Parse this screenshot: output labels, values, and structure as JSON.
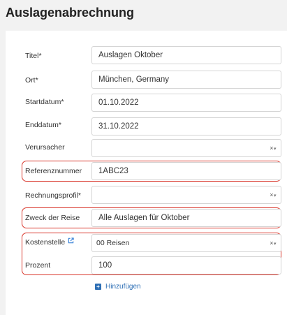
{
  "page": {
    "title": "Auslagenabrechnung"
  },
  "fields": {
    "titel": {
      "label": "Titel*",
      "value": "Auslagen Oktober"
    },
    "ort": {
      "label": "Ort*",
      "value": "München, Germany"
    },
    "startdatum": {
      "label": "Startdatum*",
      "value": "01.10.2022"
    },
    "enddatum": {
      "label": "Enddatum*",
      "value": "31.10.2022"
    },
    "verursacher": {
      "label": "Verursacher",
      "value": ""
    },
    "referenz": {
      "label": "Referenznummer",
      "value": "1ABC23"
    },
    "rechnung": {
      "label": "Rechnungsprofil*",
      "value": ""
    },
    "zweck": {
      "label": "Zweck der Reise",
      "value": "Alle Auslagen für Oktober"
    },
    "kostenstelle": {
      "label": "Kostenstelle",
      "value": "00 Reisen"
    },
    "prozent": {
      "label": "Prozent",
      "value": "100"
    }
  },
  "select_controls": {
    "clear": "×",
    "caret": "▾"
  },
  "icons": {
    "external_link": "external-link-icon",
    "add": "plus-square-icon"
  },
  "add_button": {
    "label": "Hinzufügen",
    "icon_glyph": "+"
  },
  "colors": {
    "highlight": "#d9372c",
    "link": "#2e6fb5",
    "background": "#f2f2f2"
  }
}
